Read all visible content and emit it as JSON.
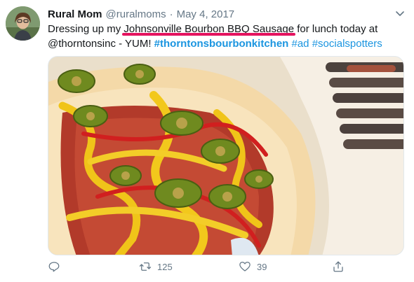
{
  "author": {
    "display_name": "Rural Mom",
    "handle": "@ruralmoms",
    "separator": "·",
    "date": "May 4, 2017"
  },
  "text": {
    "prefix": "Dressing up my ",
    "highlight": "Johnsonville Bourbon BBQ Sausage",
    "middle": " for lunch today at @thorntonsinc - YUM! ",
    "hashtags": [
      "#thorntonsbourbonkitchen",
      "#ad",
      "#socialspotters"
    ]
  },
  "stats": {
    "retweets": "125",
    "likes": "39"
  },
  "icons": {
    "reply": "reply-icon",
    "retweet": "retweet-icon",
    "like": "heart-icon",
    "share": "share-icon",
    "menu": "chevron-down-icon"
  },
  "colors": {
    "accent": "#1b95e0",
    "highlight_underline": "#e4135f",
    "muted": "#657786"
  }
}
